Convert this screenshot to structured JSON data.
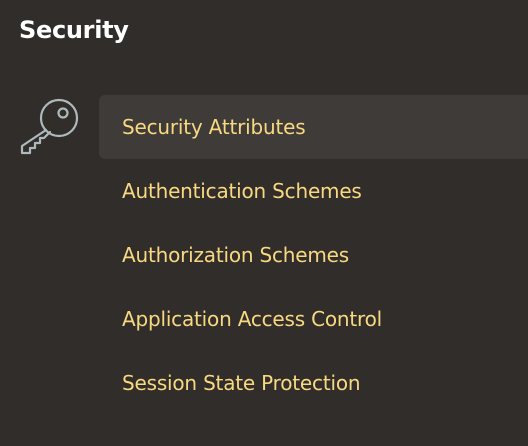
{
  "section": {
    "title": "Security",
    "icon": "key-icon"
  },
  "nav": {
    "active_index": 0,
    "items": [
      {
        "label": "Security Attributes"
      },
      {
        "label": "Authentication Schemes"
      },
      {
        "label": "Authorization Schemes"
      },
      {
        "label": "Application Access Control"
      },
      {
        "label": "Session State Protection"
      }
    ]
  },
  "colors": {
    "background": "#312d2a",
    "active_item_background": "#3f3b38",
    "link_text": "#f8d982",
    "title_text": "#ffffff",
    "icon_stroke": "#aeb9bc"
  }
}
